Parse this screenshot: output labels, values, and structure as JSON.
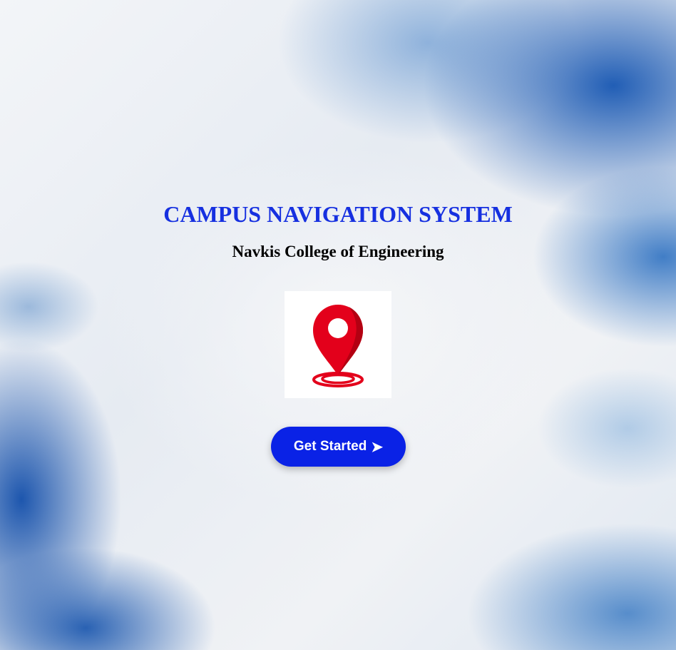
{
  "page": {
    "title": "CAMPUS NAVIGATION SYSTEM",
    "subtitle": "Navkis College of Engineering"
  },
  "logo": {
    "icon": "map-pin-icon",
    "pin_color": "#e3001b",
    "pin_shadow_color": "#b30012"
  },
  "cta": {
    "label": "Get Started",
    "arrow": "➤",
    "color": "#0a22e6"
  },
  "colors": {
    "title": "#1630e0",
    "subtitle": "#000000",
    "background_accent": "#1656b2"
  }
}
